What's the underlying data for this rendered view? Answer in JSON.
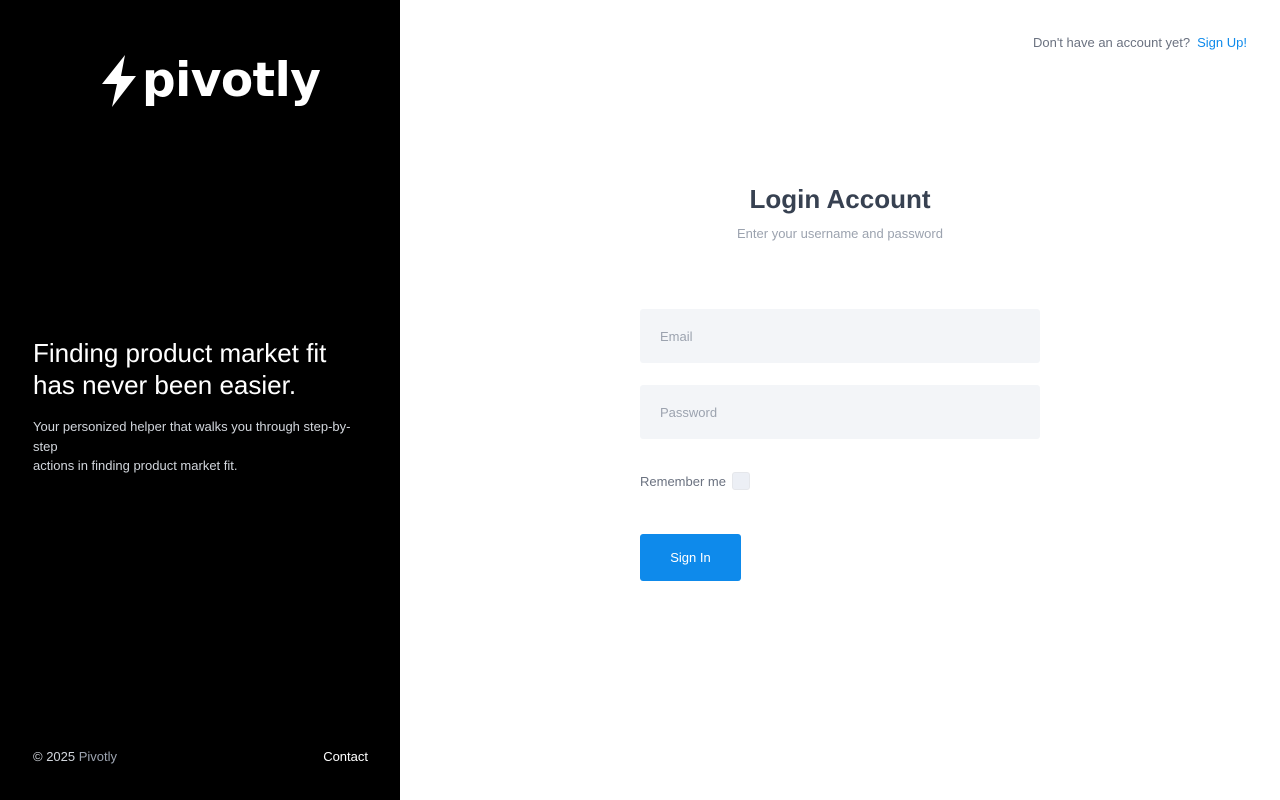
{
  "sidebar": {
    "logo_text": "pivotly",
    "logo_icon": "lightning-bolt-icon",
    "hero_title": "Finding product market fit\nhas never been easier.",
    "hero_subtitle": "Your personized helper that walks you through step-by-step\nactions in finding product market fit.",
    "copyright_prefix": "© 2025",
    "copyright_brand": "Pivotly",
    "contact_label": "Contact"
  },
  "header": {
    "prompt": "Don't have an account yet?",
    "signup_label": "Sign Up!"
  },
  "login": {
    "title": "Login Account",
    "subtitle": "Enter your username and password",
    "email_placeholder": "Email",
    "email_value": "",
    "password_placeholder": "Password",
    "password_value": "",
    "remember_label": "Remember me",
    "remember_checked": false,
    "submit_label": "Sign In"
  },
  "colors": {
    "sidebar_bg": "#000000",
    "accent": "#0e8aeb",
    "field_bg": "#f3f5f8",
    "title_text": "#374151"
  }
}
